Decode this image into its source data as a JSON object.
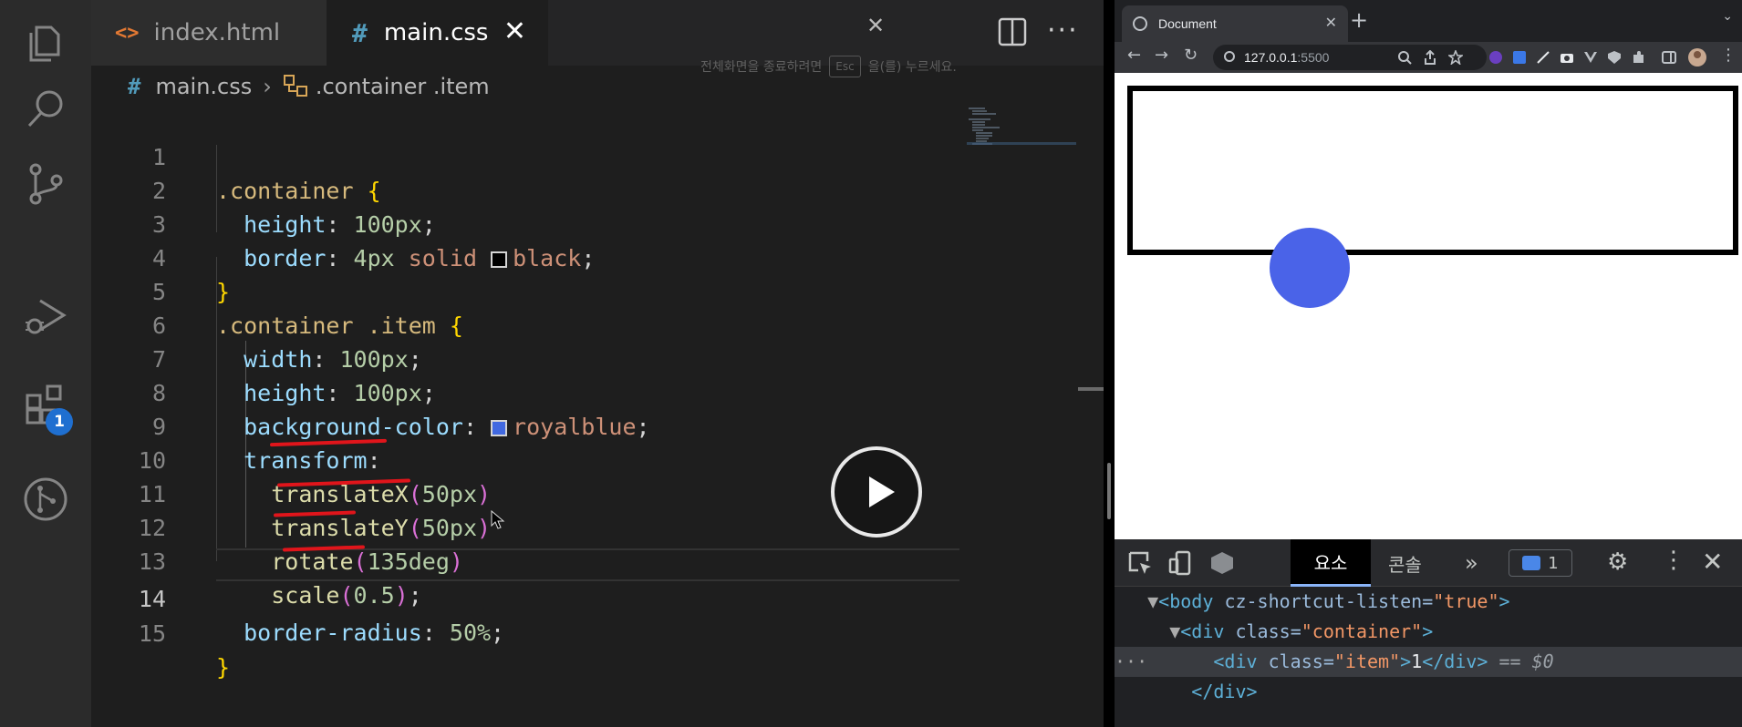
{
  "editor": {
    "tabs": [
      {
        "label": "index.html",
        "active": false
      },
      {
        "label": "main.css",
        "active": true
      }
    ],
    "fullscreen_hint": {
      "before": "전체화면을 종료하려면",
      "key": "Esc",
      "after": "을(를) 누르세요."
    },
    "breadcrumb": {
      "file": "main.css",
      "symbol": ".container .item"
    },
    "extensions_badge": "1",
    "active_line": 14,
    "lines": [
      {
        "n": "1"
      },
      {
        "n": "2"
      },
      {
        "n": "3"
      },
      {
        "n": "4"
      },
      {
        "n": "5"
      },
      {
        "n": "6"
      },
      {
        "n": "7"
      },
      {
        "n": "8"
      },
      {
        "n": "9"
      },
      {
        "n": "10"
      },
      {
        "n": "11"
      },
      {
        "n": "12"
      },
      {
        "n": "13"
      },
      {
        "n": "14"
      },
      {
        "n": "15"
      }
    ],
    "code": {
      "l1_sel": ".container",
      "l2_prop": "height",
      "l2_val": "100px",
      "l3_prop": "border",
      "l3_num": "4px",
      "l3_kw": "solid",
      "l3_color": "black",
      "l5_sel": ".container .item",
      "l6_prop": "width",
      "l6_val": "100px",
      "l7_prop": "height",
      "l7_val": "100px",
      "l8_prop": "background-color",
      "l8_color": "royalblue",
      "l9_prop": "transform",
      "l10_fn": "translateX",
      "l10_arg": "50px",
      "l11_fn": "translateY",
      "l11_arg": "50px",
      "l12_fn": "rotate",
      "l12_arg": "135deg",
      "l13_fn": "scale",
      "l13_arg": "0.5",
      "l14_prop": "border-radius",
      "l14_val": "50%"
    }
  },
  "browser": {
    "tab_title": "Document",
    "url_host": "127.0.0.1",
    "url_port": ":5500",
    "devtools": {
      "tab_elements": "요소",
      "tab_console": "콘솔",
      "more": "»",
      "issues_count": "1",
      "dom": {
        "body_tag": "body",
        "body_attr": "cz-shortcut-listen",
        "body_val": "\"true\"",
        "div_tag": "div",
        "div_attr": "class",
        "div_val": "\"container\"",
        "item_tag": "div",
        "item_attr": "class",
        "item_val": "\"item\"",
        "item_text": "1",
        "item_ref": "== $0",
        "close_div": "</div>"
      }
    }
  },
  "colors": {
    "css_black": "#000000",
    "css_royalblue": "#4169e1",
    "annotation": "#e0151b"
  }
}
